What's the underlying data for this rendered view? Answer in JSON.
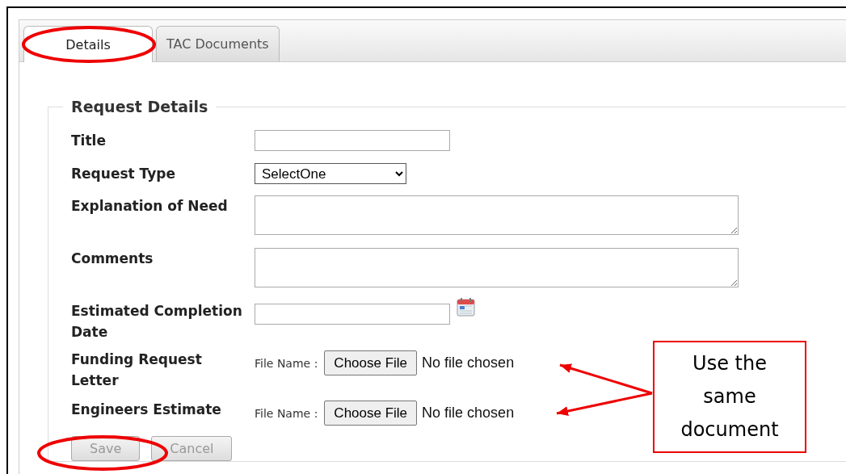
{
  "tabs": [
    {
      "label": "Details",
      "selected": true
    },
    {
      "label": "TAC Documents",
      "selected": false
    }
  ],
  "section": {
    "legend": "Request Details"
  },
  "fields": [
    {
      "kind": "text",
      "label": "Title"
    },
    {
      "kind": "select",
      "label": "Request Type",
      "value": "SelectOne"
    },
    {
      "kind": "textarea",
      "label": "Explanation of Need"
    },
    {
      "kind": "textarea",
      "label": "Comments"
    },
    {
      "kind": "date",
      "label": "Estimated Completion Date"
    },
    {
      "kind": "file",
      "label": "Funding Request Letter",
      "prefix": "File Name :",
      "button": "Choose File",
      "status": "No file chosen"
    },
    {
      "kind": "file",
      "label": "Engineers Estimate",
      "prefix": "File Name :",
      "button": "Choose File",
      "status": "No file chosen"
    }
  ],
  "buttons": [
    {
      "label": "Save",
      "disabled": true
    },
    {
      "label": "Cancel",
      "disabled": true
    }
  ],
  "annotation": {
    "callout": "Use the same document"
  }
}
